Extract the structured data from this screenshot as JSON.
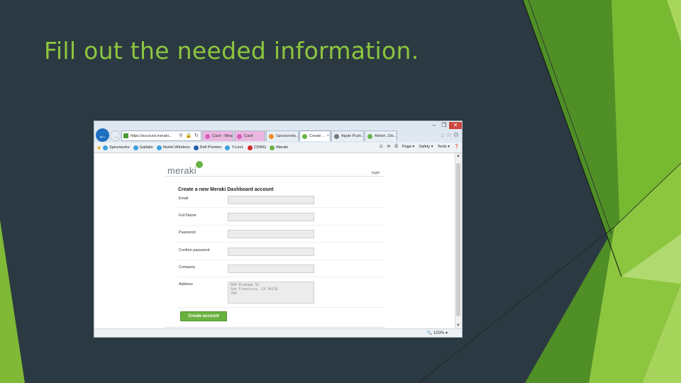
{
  "slide": {
    "title": "Fill out the needed information."
  },
  "browser": {
    "url": "https://account.meraki...",
    "tabs": [
      {
        "label": "Cacti - Wea...",
        "style": "pink",
        "icon_color": "#d65fbf"
      },
      {
        "label": "Cacti",
        "style": "pink",
        "icon_color": "#d65fbf"
      },
      {
        "label": "Spiceworks...",
        "style": "light",
        "icon_color": "#f08a24"
      },
      {
        "label": "Create ...",
        "style": "active",
        "icon_color": "#67b346"
      },
      {
        "label": "Apple Push...",
        "style": "light",
        "icon_color": "#777777"
      },
      {
        "label": "Admin, Dis...",
        "style": "light",
        "icon_color": "#67b346"
      }
    ],
    "favorites": [
      {
        "label": "Spiceworks",
        "icon_color": "#3aa0d8"
      },
      {
        "label": "Gallatin",
        "icon_color": "#3aa0d8"
      },
      {
        "label": "Nortel Wireless",
        "icon_color": "#3aa0d8"
      },
      {
        "label": "Dell Premier",
        "icon_color": "#1f5fa8"
      },
      {
        "label": "T-LevL",
        "icon_color": "#3aa0d8"
      },
      {
        "label": "CDWG",
        "icon_color": "#d12a2a"
      },
      {
        "label": "Meraki",
        "icon_color": "#67b346"
      }
    ],
    "commands": {
      "page": "Page ▾",
      "safety": "Safety ▾",
      "tools": "Tools ▾"
    },
    "zoom": "100%"
  },
  "page": {
    "logo": "meraki",
    "login": "login",
    "form_title": "Create a new Meraki Dashboard account",
    "fields": {
      "email": "Email",
      "full_name": "Full Name",
      "password": "Password",
      "confirm_password": "Confirm password",
      "company": "Company",
      "address": "Address"
    },
    "address_placeholder": [
      "660 Alabama St.",
      "San Francisco, CA 94110",
      "USA"
    ],
    "submit_label": "Create account"
  },
  "colors": {
    "accent": "#8dc63f",
    "background": "#2b3a42",
    "button": "#6ab23f"
  }
}
